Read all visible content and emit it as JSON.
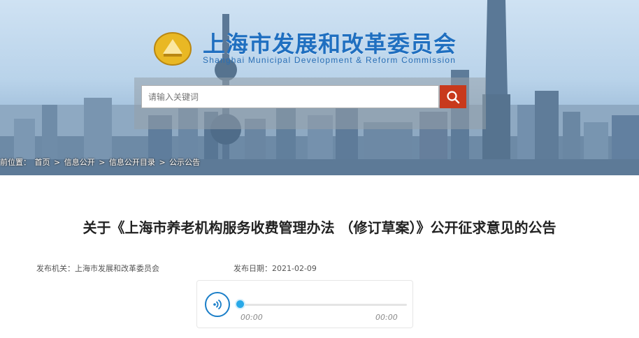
{
  "header": {
    "site_title": "上海市发展和改革委员会",
    "site_subtitle": "Shanghai Municipal Development & Reform Commission",
    "logo_icon": "municipal-emblem-icon"
  },
  "search": {
    "placeholder": "请输入关键词",
    "button_icon": "search-icon",
    "button_color": "#c8391c"
  },
  "breadcrumb": {
    "prefix": "前位置：",
    "items": [
      "首页",
      "信息公开",
      "信息公开目录",
      "公示公告"
    ],
    "separator": ">"
  },
  "article": {
    "title": "关于《上海市养老机构服务收费管理办法 （修订草案）》公开征求意见的公告",
    "publisher_label": "发布机关：",
    "publisher": "上海市发展和改革委员会",
    "date_label": "发布日期：",
    "date": "2021-02-09"
  },
  "audio_player": {
    "current_time": "00:00",
    "duration": "00:00",
    "progress": 0,
    "play_icon": "audio-speaker-icon",
    "accent_color": "#1a7ec8"
  }
}
